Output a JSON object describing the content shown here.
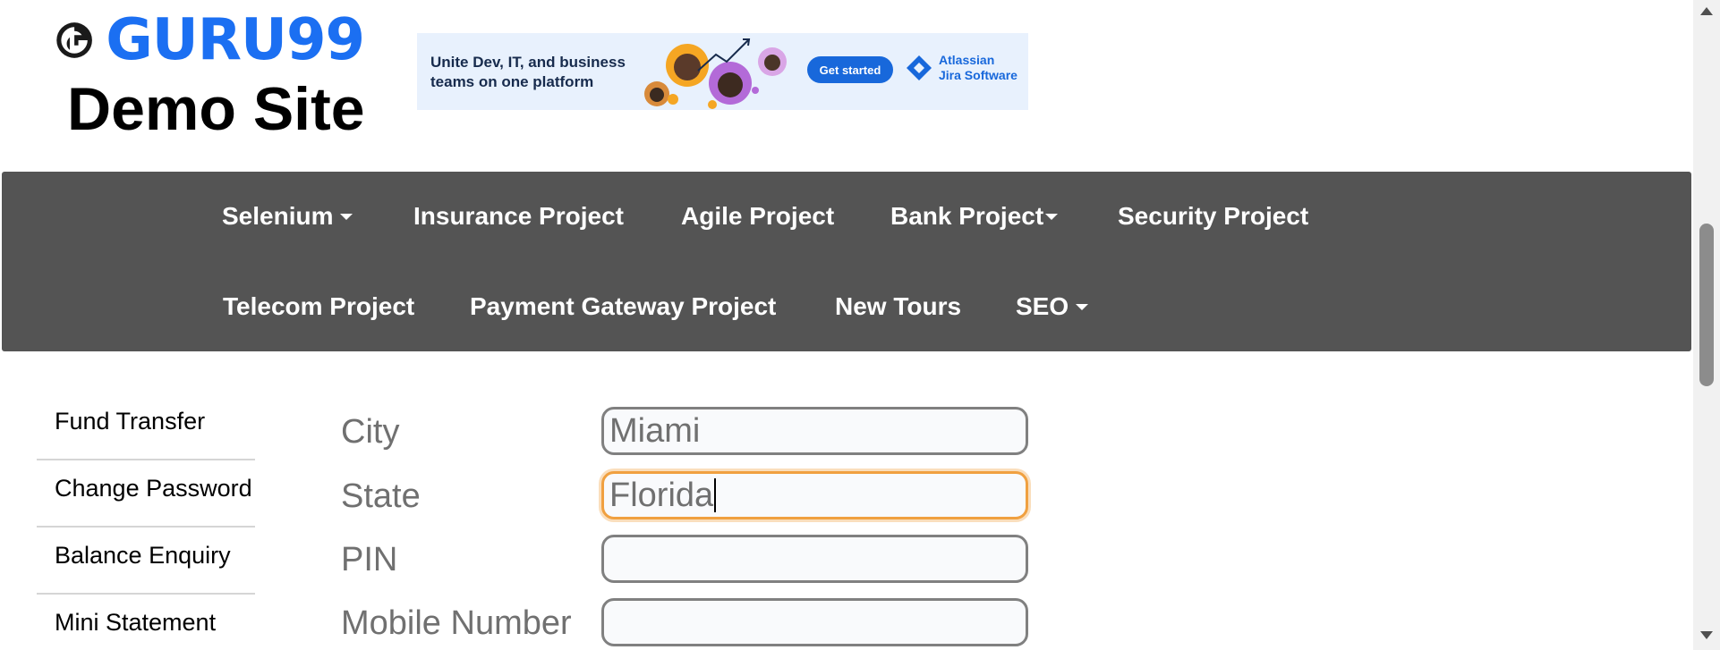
{
  "header": {
    "logo_text": "GURU99",
    "site_title": "Demo Site"
  },
  "ad": {
    "headline": "Unite Dev, IT, and business teams on one platform",
    "cta_label": "Get started",
    "brand_name": "Atlassian",
    "brand_product": "Jira Software"
  },
  "nav": {
    "items": [
      {
        "label": "Selenium",
        "has_dropdown": true
      },
      {
        "label": "Insurance Project",
        "has_dropdown": false
      },
      {
        "label": "Agile Project",
        "has_dropdown": false
      },
      {
        "label": "Bank Project",
        "has_dropdown": true
      },
      {
        "label": "Security Project",
        "has_dropdown": false
      },
      {
        "label": "Telecom Project",
        "has_dropdown": false
      },
      {
        "label": "Payment Gateway Project",
        "has_dropdown": false
      },
      {
        "label": "New Tours",
        "has_dropdown": false
      },
      {
        "label": "SEO",
        "has_dropdown": true
      }
    ]
  },
  "sidebar": {
    "items": [
      {
        "label": "Fund Transfer"
      },
      {
        "label": "Change Password"
      },
      {
        "label": "Balance Enquiry"
      },
      {
        "label": "Mini Statement"
      }
    ]
  },
  "form": {
    "fields": [
      {
        "label": "City",
        "value": "Miami"
      },
      {
        "label": "State",
        "value": "Florida"
      },
      {
        "label": "PIN",
        "value": ""
      },
      {
        "label": "Mobile Number",
        "value": ""
      }
    ]
  },
  "colors": {
    "brand_blue": "#1b6ff2",
    "nav_background": "#545454",
    "focus_ring": "#f0a040",
    "ad_background": "#e8f1fd",
    "ad_cta": "#1868db"
  }
}
